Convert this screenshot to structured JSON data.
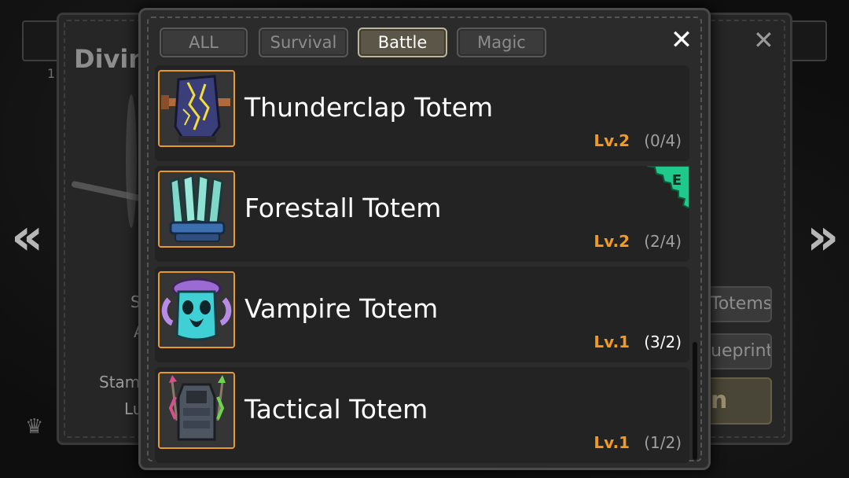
{
  "background": {
    "title": "Divin",
    "top_left_number": "1",
    "stats": [
      "S",
      "A",
      "Stam",
      "Lu"
    ],
    "buttons": [
      "Totems",
      "ueprints",
      "n"
    ],
    "nav_prev_glyph": "«",
    "nav_next_glyph": "»",
    "close_glyph": "✕"
  },
  "modal": {
    "tabs": [
      {
        "label": "ALL",
        "active": false
      },
      {
        "label": "Survival",
        "active": false
      },
      {
        "label": "Battle",
        "active": true
      },
      {
        "label": "Magic",
        "active": false
      }
    ],
    "close_glyph": "✕",
    "items": [
      {
        "name": "Thunderclap Totem",
        "level": "Lv.2",
        "count": "(0/4)",
        "equipped": false,
        "icon": "thunderclap-totem-icon"
      },
      {
        "name": "Forestall Totem",
        "level": "Lv.2",
        "count": "(2/4)",
        "equipped": true,
        "badge_letter": "E",
        "icon": "forestall-totem-icon"
      },
      {
        "name": "Vampire Totem",
        "level": "Lv.1",
        "count": "(3/2)",
        "equipped": false,
        "icon": "vampire-totem-icon"
      },
      {
        "name": "Tactical Totem",
        "level": "Lv.1",
        "count": "(1/2)",
        "equipped": false,
        "icon": "tactical-totem-icon"
      }
    ]
  },
  "colors": {
    "accent_level": "#f39b1e",
    "icon_frame": "#e89a2c",
    "active_tab": "#5b5647",
    "equip_badge": "#1fc98c"
  }
}
